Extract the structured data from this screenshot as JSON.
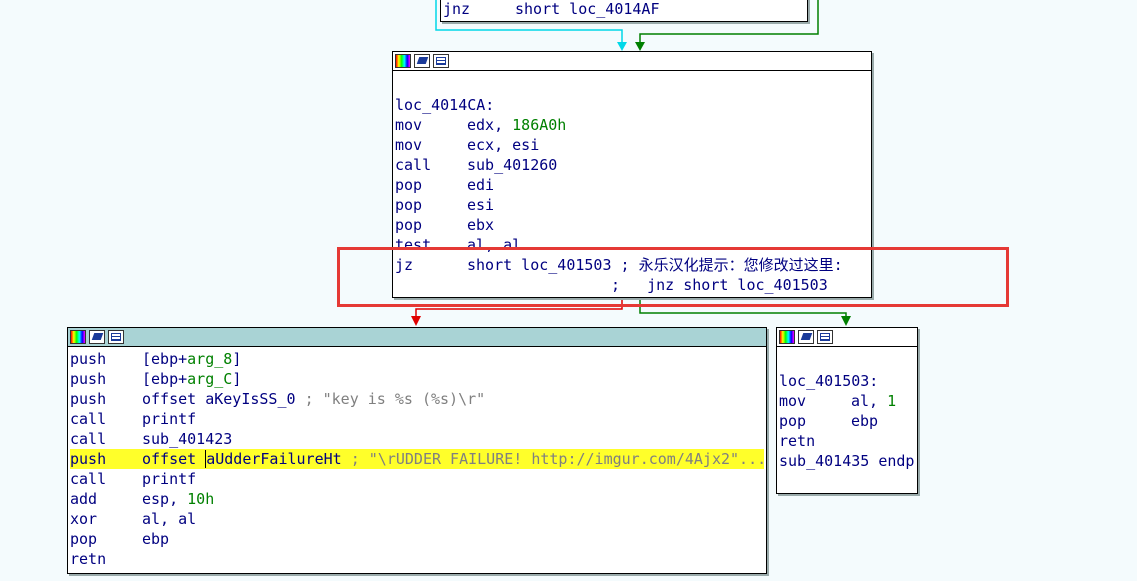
{
  "top_node": {
    "mn": "jnz",
    "op": "short loc_4014AF"
  },
  "mid_node": {
    "label": "loc_4014CA:",
    "lines": [
      {
        "mn": "mov",
        "op": "edx, ",
        "num": "186A0h"
      },
      {
        "mn": "mov",
        "op": "ecx, esi"
      },
      {
        "mn": "call",
        "op": "sub_401260"
      },
      {
        "mn": "pop",
        "op": "edi"
      },
      {
        "mn": "pop",
        "op": "esi"
      },
      {
        "mn": "pop",
        "op": "ebx"
      },
      {
        "mn": "test",
        "op": "al, al"
      }
    ],
    "jz_mn": "jz",
    "jz_op": "short loc_401503 ; 永乐汉化提示：您修改过这里:",
    "jz_cont": ";   jnz short loc_401503"
  },
  "left_node": {
    "lines": [
      {
        "mn": "push",
        "a": "[ebp+",
        "g": "arg_8",
        "b": "]"
      },
      {
        "mn": "push",
        "a": "[ebp+",
        "g": "arg_C",
        "b": "]"
      },
      {
        "mn": "push",
        "a": "offset aKeyIsSS_0 ",
        "cmt": "; \"key is %s (%s)\\r\""
      },
      {
        "mn": "call",
        "a": "printf"
      },
      {
        "mn": "call",
        "a": "sub_401423"
      },
      {
        "mn": "push",
        "a": "offset ",
        "cursor": "a",
        "a2": "UdderFailureHt ",
        "cmt": "; \"\\rUDDER FAILURE! http://imgur.com/4Ajx2\"..."
      },
      {
        "mn": "call",
        "a": "printf"
      },
      {
        "mn": "add",
        "a": "esp, ",
        "g": "10h"
      },
      {
        "mn": "xor",
        "a": "al, al"
      },
      {
        "mn": "pop",
        "a": "ebp"
      },
      {
        "mn": "retn",
        "a": ""
      }
    ]
  },
  "right_node": {
    "label": "loc_401503:",
    "lines": [
      {
        "mn": "mov",
        "a": "al, ",
        "g": "1"
      },
      {
        "mn": "pop",
        "a": "ebp"
      },
      {
        "mn": "retn",
        "a": ""
      }
    ],
    "endp": "sub_401435 endp"
  },
  "colors": {
    "true_edge": "#008000",
    "false_edge": "#e00000",
    "uncond_edge": "#00d8e8",
    "highlight": "#ffff2a",
    "annotation_box": "#e53935"
  }
}
